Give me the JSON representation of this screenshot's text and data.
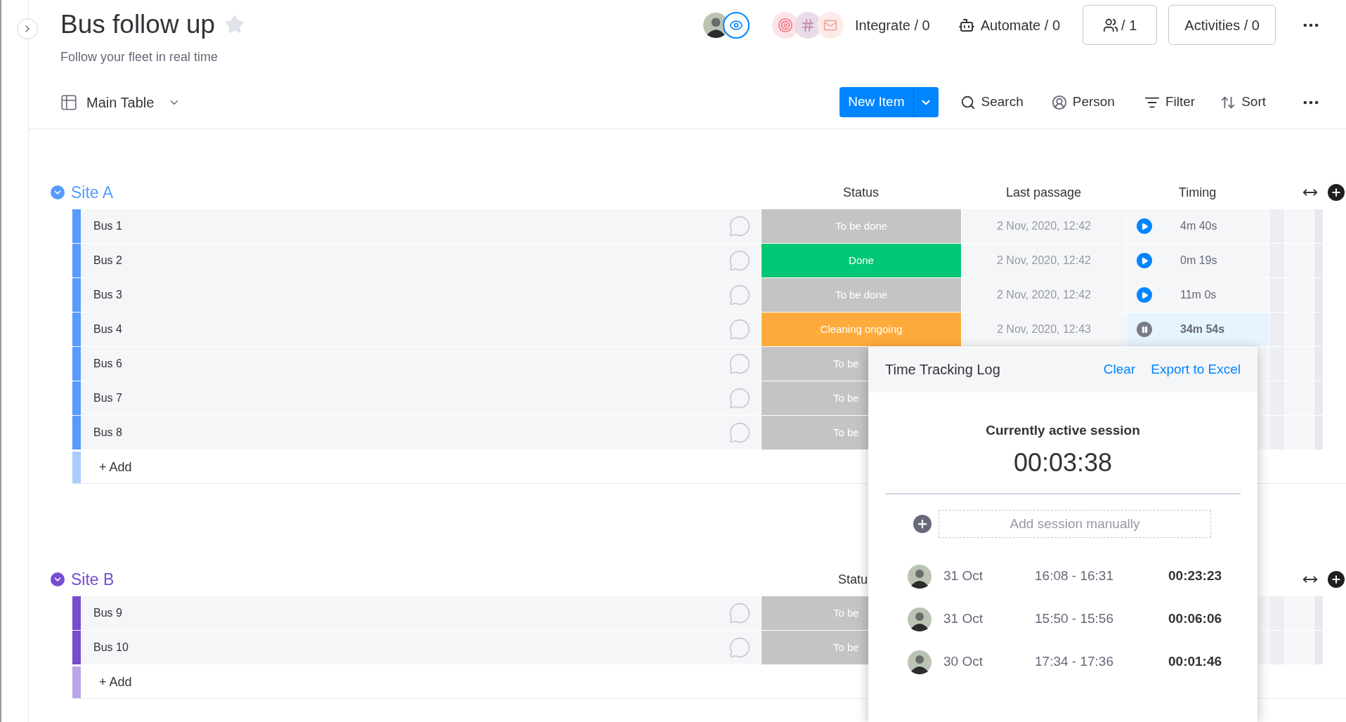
{
  "board": {
    "title": "Bus follow up",
    "subtitle": "Follow your fleet in real time",
    "starred": false
  },
  "header_actions": {
    "integrate": "Integrate / 0",
    "automate": "Automate / 0",
    "members": "/ 1",
    "activities": "Activities / 0"
  },
  "toolbar": {
    "view": "Main Table",
    "new_item": "New Item",
    "search": "Search",
    "person": "Person",
    "filter": "Filter",
    "sort": "Sort"
  },
  "groups": [
    {
      "title": "Site A",
      "color": "#579bfc",
      "columns": [
        "Status",
        "Last passage",
        "Timing"
      ],
      "add_label": "+ Add",
      "rows": [
        {
          "name": "Bus 1",
          "status": {
            "label": "To be done",
            "color": "#c4c4c4",
            "covered": false
          },
          "last_passage": "2 Nov, 2020, 12:42",
          "timing": {
            "value": "4m 40s",
            "running": false
          }
        },
        {
          "name": "Bus 2",
          "status": {
            "label": "Done",
            "color": "#00c875",
            "covered": false
          },
          "last_passage": "2 Nov, 2020, 12:42",
          "timing": {
            "value": "0m 19s",
            "running": false
          }
        },
        {
          "name": "Bus 3",
          "status": {
            "label": "To be done",
            "color": "#c4c4c4",
            "covered": false
          },
          "last_passage": "2 Nov, 2020, 12:42",
          "timing": {
            "value": "11m 0s",
            "running": false
          }
        },
        {
          "name": "Bus 4",
          "status": {
            "label": "Cleaning ongoing",
            "color": "#fdab3d",
            "covered": false
          },
          "last_passage": "2 Nov, 2020, 12:43",
          "timing": {
            "value": "34m 54s",
            "running": true
          }
        },
        {
          "name": "Bus 6",
          "status": {
            "label": "To be",
            "color": "#c4c4c4",
            "covered": true
          }
        },
        {
          "name": "Bus 7",
          "status": {
            "label": "To be",
            "color": "#c4c4c4",
            "covered": true
          }
        },
        {
          "name": "Bus 8",
          "status": {
            "label": "To be",
            "color": "#c4c4c4",
            "covered": true
          }
        }
      ]
    },
    {
      "title": "Site B",
      "color": "#784bd1",
      "columns": [
        "Statu"
      ],
      "add_label": "+ Add",
      "rows": [
        {
          "name": "Bus 9",
          "status": {
            "label": "To be",
            "color": "#c4c4c4",
            "covered": true
          }
        },
        {
          "name": "Bus 10",
          "status": {
            "label": "To be",
            "color": "#c4c4c4",
            "covered": true
          }
        }
      ]
    }
  ],
  "time_log": {
    "title": "Time Tracking Log",
    "clear": "Clear",
    "export": "Export to Excel",
    "active_label": "Currently active session",
    "active_time": "00:03:38",
    "add_placeholder": "Add session manually",
    "sessions": [
      {
        "date": "31 Oct",
        "range": "16:08 - 16:31",
        "duration": "00:23:23"
      },
      {
        "date": "31 Oct",
        "range": "15:50 - 15:56",
        "duration": "00:06:06"
      },
      {
        "date": "30 Oct",
        "range": "17:34 - 17:36",
        "duration": "00:01:46"
      }
    ]
  }
}
